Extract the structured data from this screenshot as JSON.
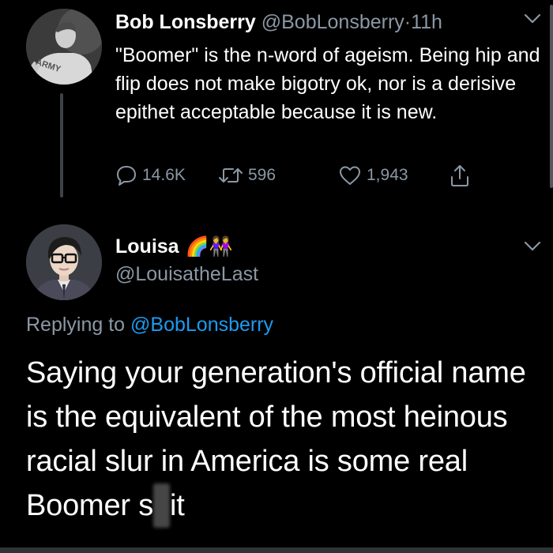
{
  "parent_tweet": {
    "author_name": "Bob Lonsberry",
    "author_handle": "@BobLonsberry",
    "separator": "·",
    "time": "11h",
    "text": "\"Boomer\" is the n-word of ageism. Being hip and flip does not make bigotry ok, nor is a derisive epithet acceptable because it is new.",
    "avatar_shirt_text": "ARMY",
    "replies": "14.6K",
    "retweets": "596",
    "likes": "1,943",
    "icons": {
      "reply": "comment-icon",
      "retweet": "retweet-icon",
      "like": "heart-icon",
      "share": "share-icon",
      "more": "chevron-down-icon"
    }
  },
  "reply_tweet": {
    "author_name": "Louisa",
    "name_emojis": "🌈👭",
    "author_handle": "@LouisatheLast",
    "replying_prefix": "Replying to",
    "replying_to": "@BobLonsberry",
    "text_main": "Saying your generation's official name is the equivalent of the most heinous racial slur in America is some real Boomer s",
    "text_censored": "h",
    "text_end": "it"
  },
  "colors": {
    "background": "#000000",
    "text": "#ffffff",
    "secondary_text": "#8b98a5",
    "link": "#1d9bf0",
    "thread_line": "#3d4148"
  }
}
